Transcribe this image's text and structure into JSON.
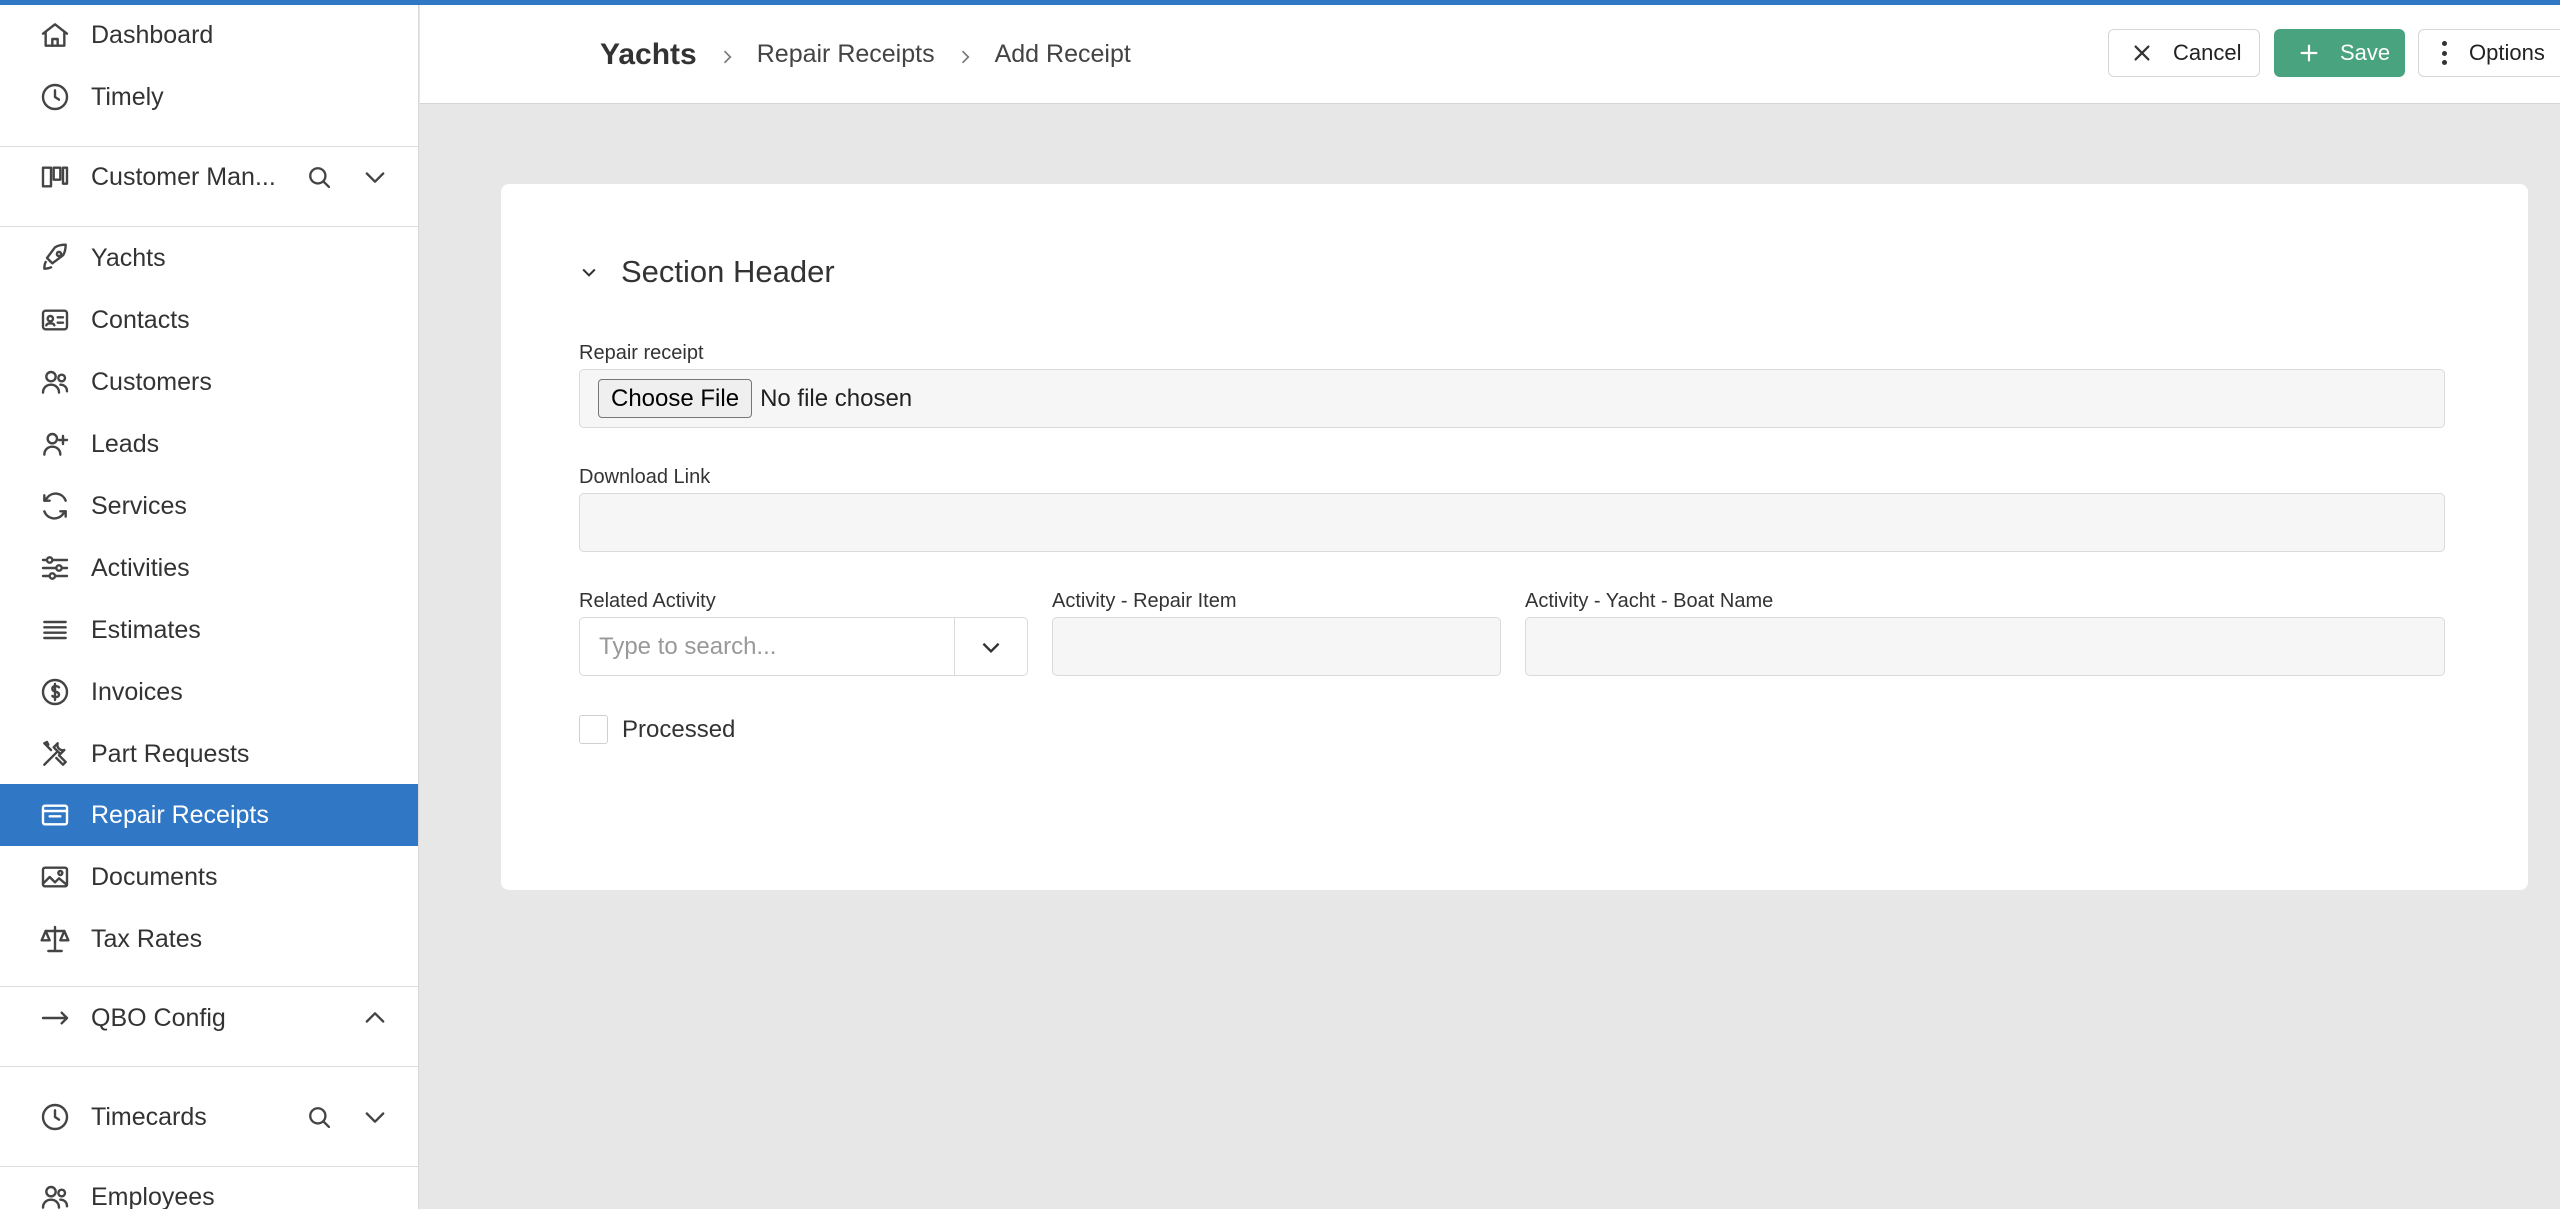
{
  "sidebar": {
    "items": [
      {
        "label": "Dashboard",
        "icon": "home-icon"
      },
      {
        "label": "Timely",
        "icon": "clock-icon"
      },
      {
        "label": "Customer Man...",
        "icon": "kanban-icon"
      },
      {
        "label": "Yachts",
        "icon": "rocket-icon"
      },
      {
        "label": "Contacts",
        "icon": "contact-card-icon"
      },
      {
        "label": "Customers",
        "icon": "users-icon"
      },
      {
        "label": "Leads",
        "icon": "user-plus-icon"
      },
      {
        "label": "Services",
        "icon": "refresh-icon"
      },
      {
        "label": "Activities",
        "icon": "sliders-icon"
      },
      {
        "label": "Estimates",
        "icon": "list-icon"
      },
      {
        "label": "Invoices",
        "icon": "dollar-circle-icon"
      },
      {
        "label": "Part Requests",
        "icon": "tools-icon"
      },
      {
        "label": "Repair Receipts",
        "icon": "inbox-icon"
      },
      {
        "label": "Documents",
        "icon": "image-icon"
      },
      {
        "label": "Tax Rates",
        "icon": "scale-icon"
      },
      {
        "label": "QBO Config",
        "icon": "arrow-right-icon"
      },
      {
        "label": "Timecards",
        "icon": "clock-icon"
      },
      {
        "label": "Employees",
        "icon": "users-icon"
      }
    ],
    "active": "Repair Receipts"
  },
  "header": {
    "breadcrumb": {
      "root": "Yachts",
      "level1": "Repair Receipts",
      "level2": "Add Receipt"
    },
    "cancel_label": "Cancel",
    "save_label": "Save",
    "options_label": "Options"
  },
  "colors": {
    "accent": "#3077c6",
    "save": "#4aa37f",
    "background": "#e7e7e7"
  },
  "form": {
    "section_title": "Section Header",
    "repair_receipt_label": "Repair receipt",
    "choose_file_label": "Choose File",
    "file_status": "No file chosen",
    "download_link_label": "Download Link",
    "download_link_value": "",
    "related_activity_label": "Related Activity",
    "related_activity_placeholder": "Type to search...",
    "repair_item_label": "Activity - Repair Item",
    "repair_item_value": "",
    "boat_name_label": "Activity - Yacht - Boat Name",
    "boat_name_value": "",
    "processed_label": "Processed",
    "processed_checked": false
  }
}
